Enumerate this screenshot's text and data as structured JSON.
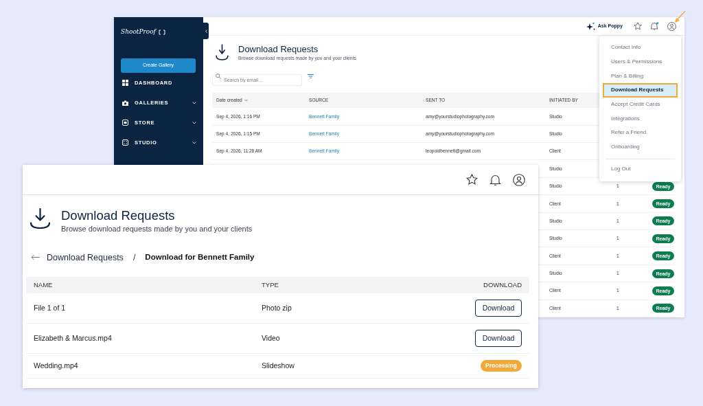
{
  "back_window": {
    "sidebar": {
      "logo": "ShootProof",
      "create_button": "Create Gallery",
      "items": [
        {
          "label": "DASHBOARD",
          "expandable": false
        },
        {
          "label": "GALLERIES",
          "expandable": true
        },
        {
          "label": "STORE",
          "expandable": true
        },
        {
          "label": "STUDIO",
          "expandable": true
        }
      ]
    },
    "topbar": {
      "assistant": "Ask Poppy",
      "notification": true
    },
    "header": {
      "title": "Download Requests",
      "subtitle": "Browse download requests made by you and your clients"
    },
    "search": {
      "placeholder": "Search by email..."
    },
    "table": {
      "columns": [
        "Date created",
        "SOURCE",
        "SENT TO",
        "INITIATED BY"
      ],
      "rows": [
        {
          "date_created": "Sep 4, 2026, 1:16 PM",
          "source": "Bennett Family",
          "sent_to": "amy@yourstudiophotography.com",
          "initiated_by": "Studio"
        },
        {
          "date_created": "Sep 4, 2026, 1:15 PM",
          "source": "Bennett Family",
          "sent_to": "amy@yourstudiophotography.com",
          "initiated_by": "Studio"
        },
        {
          "date_created": "Sep 4, 2026, 11:28 AM",
          "source": "Bennett Family",
          "sent_to": "leopoldbennett@gmail.com",
          "initiated_by": "Client"
        },
        {
          "initiated_by": "Studio"
        },
        {
          "initiated_by": "Studio",
          "column_5": "1",
          "status": "Ready"
        },
        {
          "initiated_by": "Client",
          "column_5": "1",
          "status": "Ready"
        },
        {
          "initiated_by": "Studio",
          "column_5": "1",
          "status": "Ready"
        },
        {
          "initiated_by": "Studio",
          "column_5": "1",
          "status": "Ready"
        },
        {
          "initiated_by": "Client",
          "column_5": "1",
          "status": "Ready"
        },
        {
          "initiated_by": "Studio",
          "column_5": "1",
          "status": "Ready"
        },
        {
          "initiated_by": "Client",
          "column_5": "1",
          "status": "Ready"
        },
        {
          "initiated_by": "Client",
          "column_5": "1",
          "status": "Ready"
        }
      ]
    }
  },
  "account_menu": {
    "items": [
      {
        "label": "Contact Info",
        "selected": false
      },
      {
        "label": "Users & Permissions",
        "selected": false
      },
      {
        "label": "Plan & Billing",
        "selected": false
      },
      {
        "label": "Download Requests",
        "selected": true
      },
      {
        "label": "Accept Credit Cards",
        "selected": false
      },
      {
        "label": "Integrations",
        "selected": false
      },
      {
        "label": "Refer a Friend",
        "selected": false
      },
      {
        "label": "Onboarding",
        "selected": false
      }
    ],
    "logout": "Log Out"
  },
  "front_window": {
    "header": {
      "title": "Download Requests",
      "subtitle": "Browse download requests made by you and your clients"
    },
    "breadcrumb": {
      "parent": "Download Requests",
      "separator": "/",
      "current": "Download for Bennett Family"
    },
    "table": {
      "columns": [
        "NAME",
        "TYPE",
        "DOWNLOAD"
      ],
      "rows": [
        {
          "name": "File 1 of 1",
          "type": "Photo zip",
          "download": {
            "kind": "button",
            "label": "Download"
          }
        },
        {
          "name": "Elizabeth & Marcus.mp4",
          "type": "Video",
          "download": {
            "kind": "button",
            "label": "Download"
          }
        },
        {
          "name": "Wedding.mp4",
          "type": "Slideshow",
          "download": {
            "kind": "badge",
            "label": "Processing"
          }
        }
      ]
    }
  }
}
